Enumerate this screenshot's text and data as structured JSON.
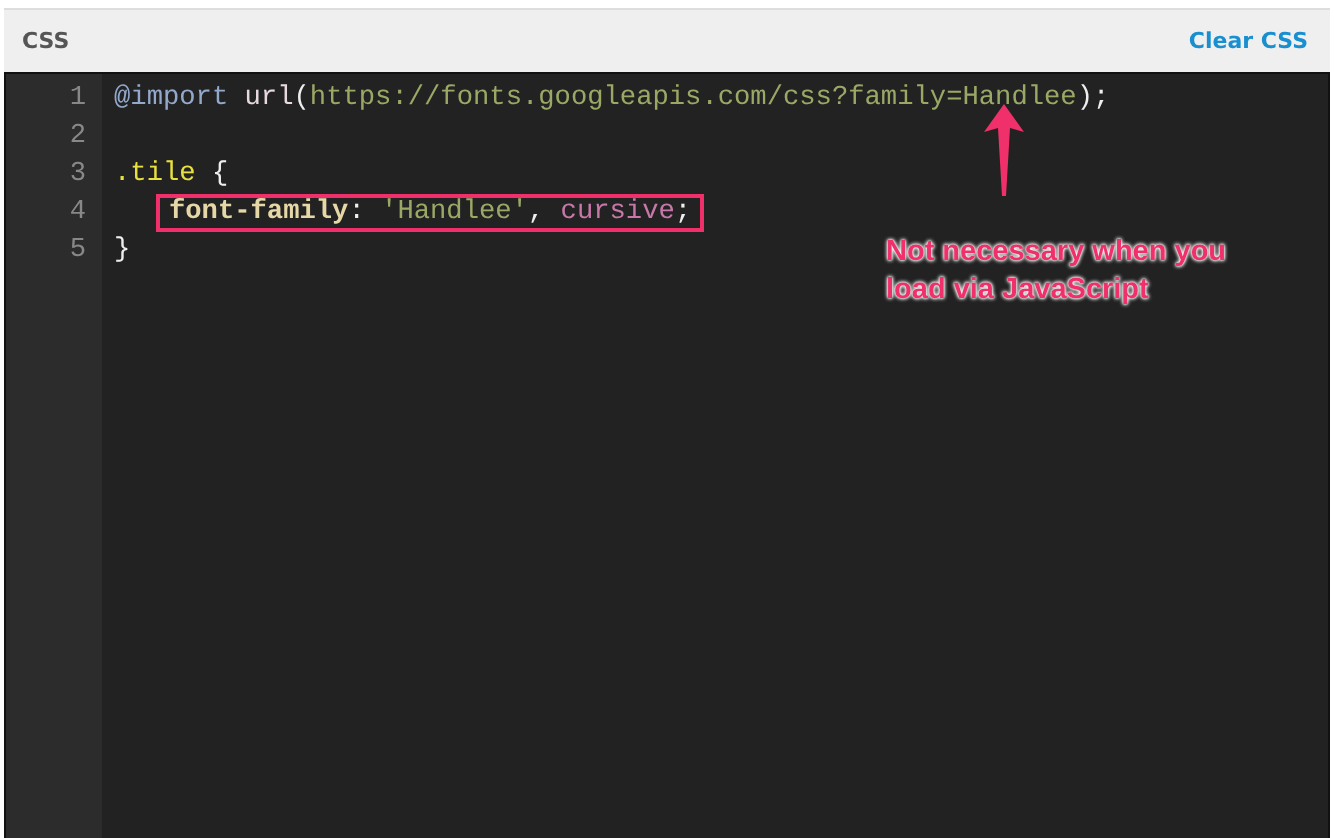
{
  "panel": {
    "title": "CSS",
    "action": "Clear CSS"
  },
  "editor": {
    "lines": [
      {
        "number": "1",
        "highlighted": false,
        "tokens": [
          {
            "kind": "keyword",
            "text": "@import "
          },
          {
            "kind": "func",
            "text": "url"
          },
          {
            "kind": "plain",
            "text": "("
          },
          {
            "kind": "string",
            "text": "https://fonts.googleapis.com/css?family=Handlee"
          },
          {
            "kind": "plain",
            "text": ");"
          }
        ]
      },
      {
        "number": "2",
        "highlighted": false
      },
      {
        "number": "3",
        "highlighted": false,
        "tokens": [
          {
            "kind": "selector",
            "text": ".tile"
          },
          {
            "kind": "plain",
            "text": " {"
          }
        ],
        "children": [
          {
            "number": "4",
            "highlighted": true,
            "tokens": [
              {
                "kind": "property",
                "text": "font-family"
              },
              {
                "kind": "plain",
                "text": ": "
              },
              {
                "kind": "string",
                "text": "'Handlee'"
              },
              {
                "kind": "plain",
                "text": ", "
              },
              {
                "kind": "value",
                "text": "cursive"
              },
              {
                "kind": "plain",
                "text": ";"
              }
            ]
          }
        ]
      },
      {
        "number": "5",
        "highlighted": false,
        "tokens": [
          {
            "kind": "plain",
            "text": "}"
          }
        ]
      }
    ]
  },
  "annotation": {
    "text": "Not necessary when you load via JavaScript"
  }
}
